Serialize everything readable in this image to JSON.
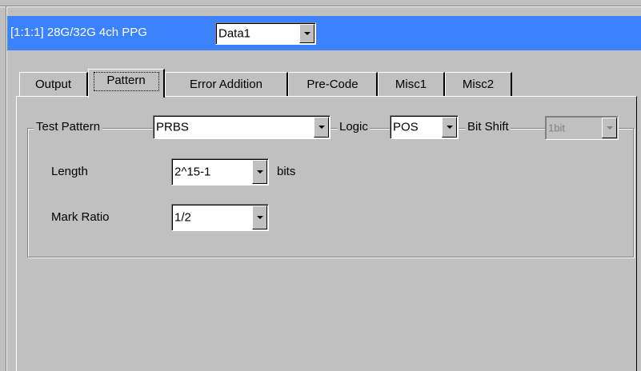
{
  "titlebar": {
    "text": "[1:1:1] 28G/32G 4ch PPG",
    "data_select": "Data1"
  },
  "tabs": [
    {
      "label": "Output",
      "active": false
    },
    {
      "label": "Pattern",
      "active": true
    },
    {
      "label": "Error Addition",
      "active": false
    },
    {
      "label": "Pre-Code",
      "active": false
    },
    {
      "label": "Misc1",
      "active": false
    },
    {
      "label": "Misc2",
      "active": false
    }
  ],
  "pattern": {
    "test_pattern_label": "Test Pattern",
    "test_pattern_value": "PRBS",
    "logic_label": "Logic",
    "logic_value": "POS",
    "bit_shift_label": "Bit Shift",
    "bit_shift_value": "1bit",
    "length_label": "Length",
    "length_value": "2^15-1",
    "length_unit": "bits",
    "mark_ratio_label": "Mark Ratio",
    "mark_ratio_value": "1/2"
  },
  "colors": {
    "titlebar_bg": "#3c82ff",
    "window_bg": "#c0c0c0"
  }
}
